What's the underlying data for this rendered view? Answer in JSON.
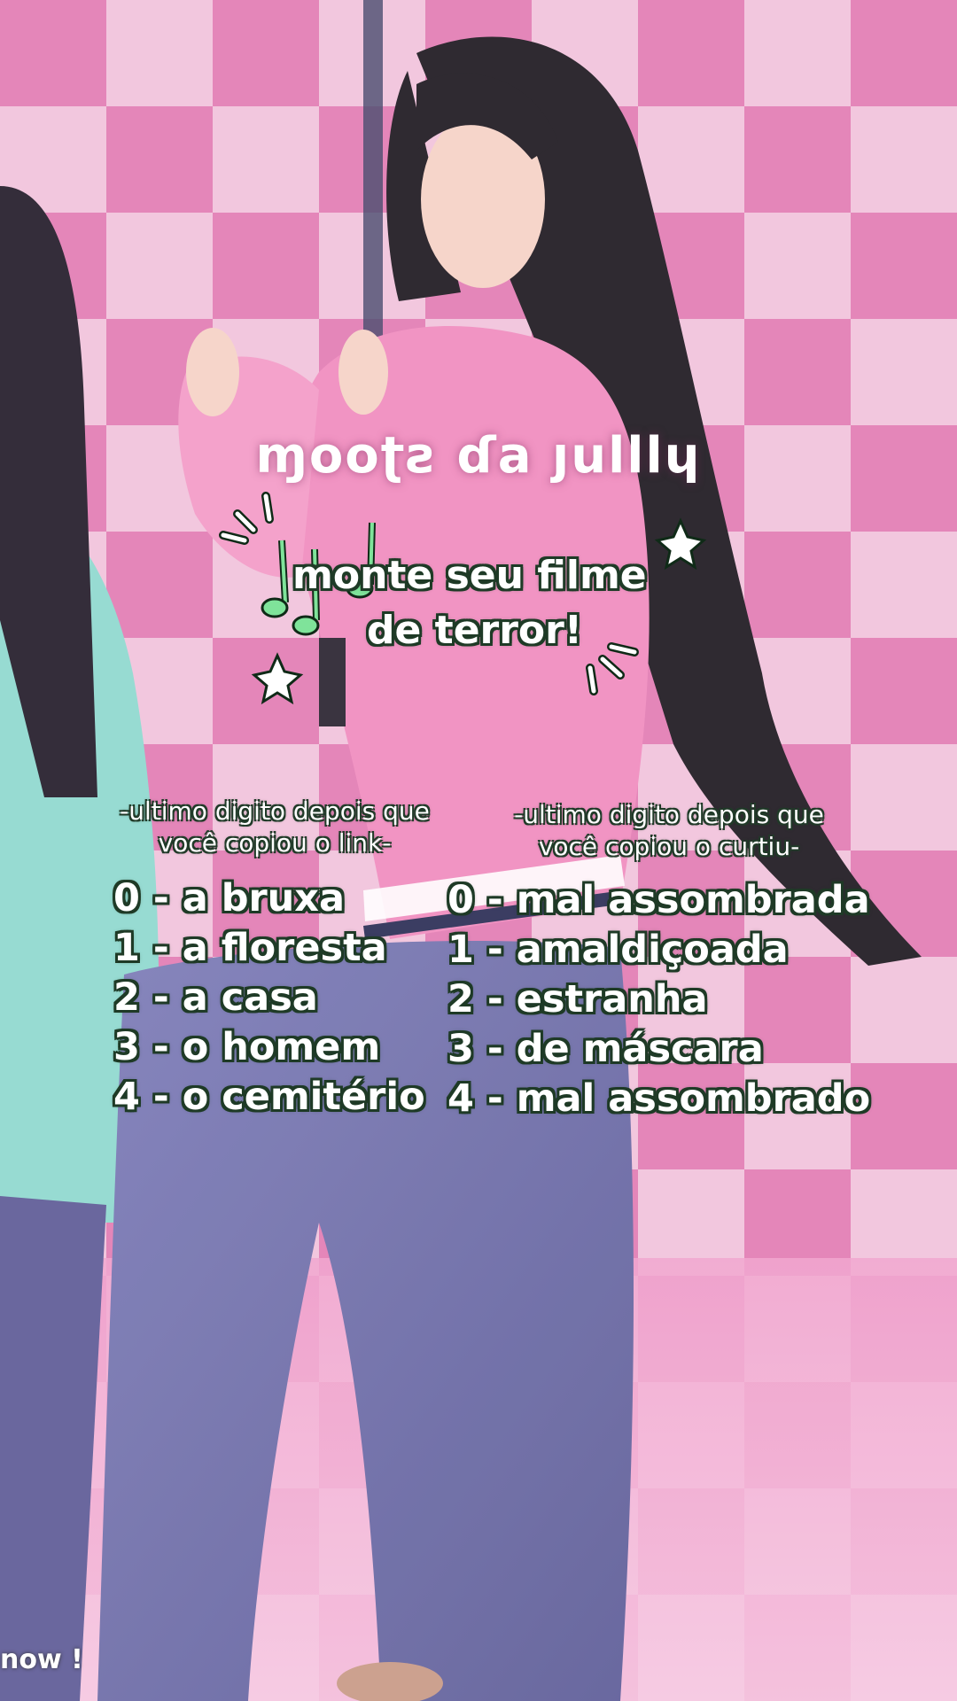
{
  "title": "ɱooʈƨ ɗa ȷulllɥ",
  "subtitle": {
    "line1": "monte seu filme",
    "line2": "de terror!"
  },
  "left_column": {
    "header_line1": "-ultimo digito depois que",
    "header_line2": "você copiou o link-",
    "items": [
      "0 - a bruxa",
      "1  - a floresta",
      "2 - a casa",
      "3 - o homem",
      "4 - o cemitério"
    ]
  },
  "right_column": {
    "header_line1": "-ultimo digito depois que",
    "header_line2": "você copiou o curtiu-",
    "items": [
      "0 - mal assombrada",
      "1  - amaldiçoada",
      "2 - estranha",
      "3 - de máscara",
      "4 - mal assombrado"
    ]
  },
  "watermark": "now !",
  "colors": {
    "background_pink": "#e9a3c8",
    "checker_light": "#f3c9de",
    "checker_dark": "#e07fb2",
    "text_outline": "#1e3a26",
    "accent_green": "#7fe39a"
  },
  "icons": [
    "music-notes-icon",
    "sparkle-lines-icon",
    "star-icon"
  ]
}
